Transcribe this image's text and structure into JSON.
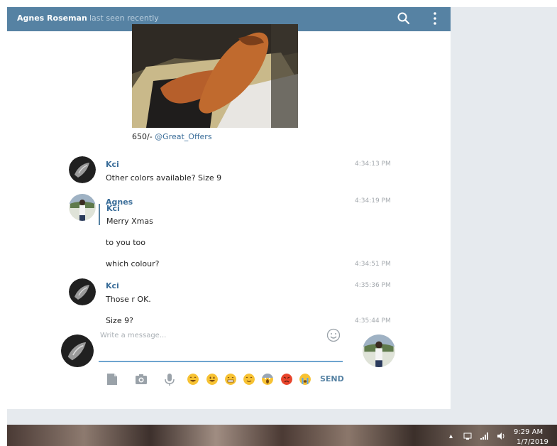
{
  "header": {
    "contact_name": "Agnes Roseman",
    "status": "last seen recently",
    "icons": [
      "search-icon",
      "more-vertical-icon"
    ]
  },
  "post": {
    "image": "brown-leather-loafers-in-box-photo",
    "price_text": "650/- ",
    "channel_link": "@Great_Offers"
  },
  "messages": [
    {
      "author": "Kci",
      "text": "Other colors available? Size 9",
      "time": "4:34:13 PM"
    },
    {
      "author": "Agnes",
      "reply_to": {
        "author": "Kci",
        "text": "Merry Xmas"
      },
      "text": "to you too",
      "time": "4:34:19 PM"
    },
    {
      "text": "which colour?",
      "time": "4:34:51 PM"
    },
    {
      "author": "Kci",
      "text": "Those r OK.",
      "time": "4:35:36 PM"
    },
    {
      "text": "Size 9?",
      "time": "4:35:44 PM"
    }
  ],
  "composer": {
    "placeholder": "Write a message...",
    "send_label": "SEND",
    "tools": [
      "attach-file-icon",
      "camera-icon",
      "microphone-icon"
    ],
    "quick_emojis": [
      "grinning-emoji",
      "smiley-emoji",
      "grimacing-emoji",
      "blush-emoji",
      "scream-emoji",
      "angry-emoji",
      "sob-emoji"
    ]
  },
  "taskbar": {
    "time": "9:29 AM",
    "date": "1/7/2019",
    "tray_icons": [
      "chevron-up-icon",
      "network-icon",
      "signal-icon",
      "volume-icon"
    ]
  },
  "colors": {
    "header": "#5682a3",
    "link": "#3a6d99",
    "input_underline": "#6ea4cf",
    "page_background": "#e6eaee"
  }
}
